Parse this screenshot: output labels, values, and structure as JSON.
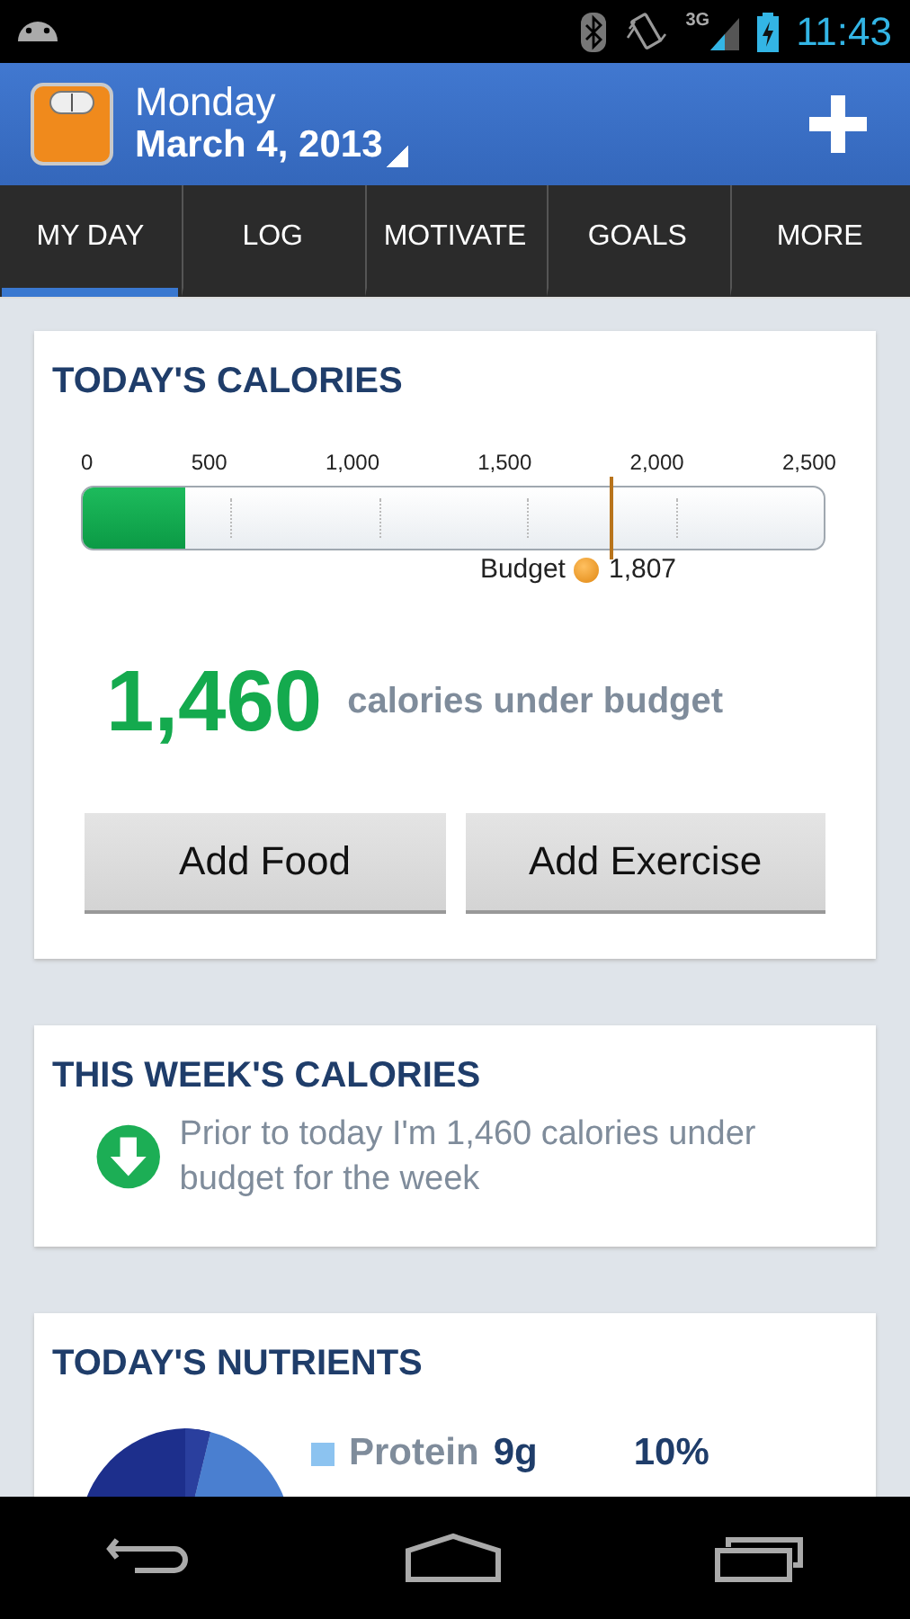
{
  "status_bar": {
    "network": "3G",
    "time": "11:43"
  },
  "app_bar": {
    "day": "Monday",
    "date": "March 4, 2013"
  },
  "tabs": [
    {
      "label": "MY DAY",
      "selected": true
    },
    {
      "label": "LOG",
      "selected": false
    },
    {
      "label": "MOTIVATE",
      "selected": false
    },
    {
      "label": "GOALS",
      "selected": false
    },
    {
      "label": "MORE",
      "selected": false
    }
  ],
  "todays_calories": {
    "title": "TODAY'S CALORIES",
    "ticks": [
      "0",
      "500",
      "1,000",
      "1,500",
      "2,000",
      "2,500"
    ],
    "consumed": {
      "level": 0.139
    },
    "budget_marker": {
      "label": "Budget",
      "value": "1,807",
      "level": 0.71
    },
    "remaining": "1,460",
    "remaining_label": "calories under budget",
    "buttons": [
      "Add Food",
      "Add Exercise"
    ]
  },
  "weeks_calories": {
    "title": "THIS WEEK'S CALORIES",
    "message": "Prior to today I'm 1,460 calories under budget for the week"
  },
  "todays_nutrients": {
    "title": "TODAY'S NUTRIENTS",
    "legend": [
      {
        "name": "Protein",
        "amount": "9g",
        "percent": "10%",
        "color": "#8cc3f0"
      }
    ]
  }
}
